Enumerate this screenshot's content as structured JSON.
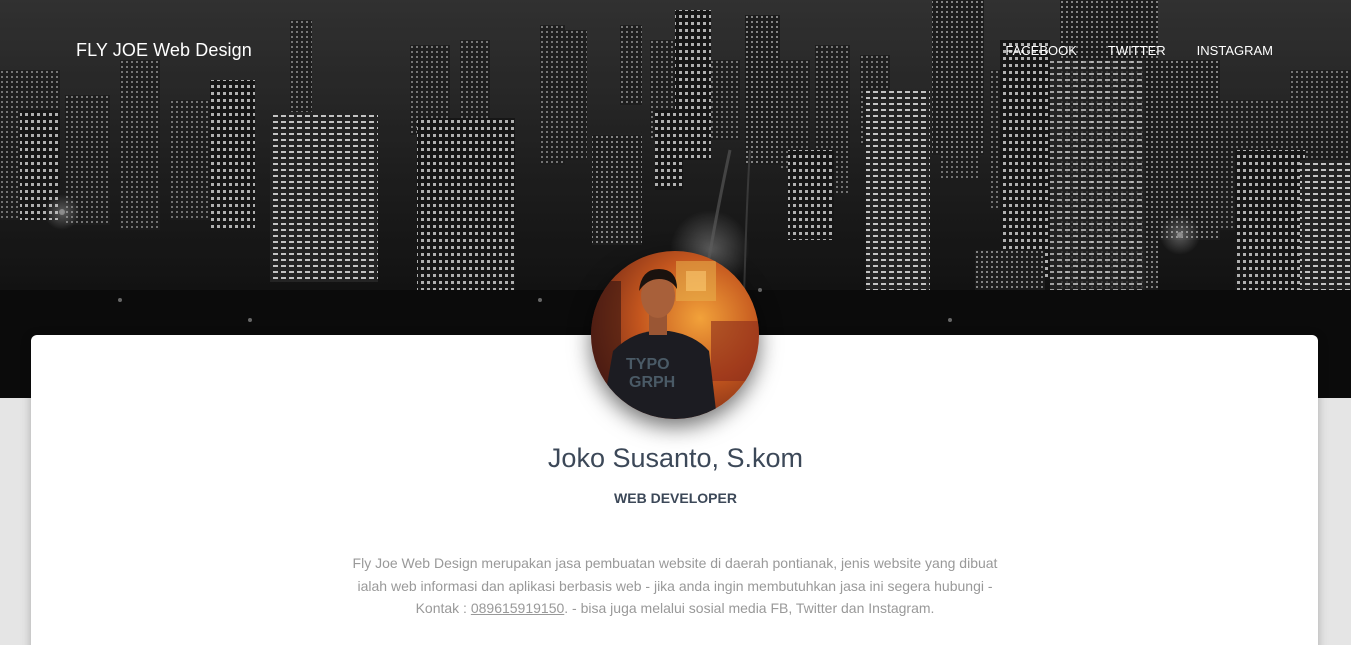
{
  "navbar": {
    "brand": "FLY JOE Web Design",
    "links": [
      "FACEBOOK",
      "TWITTER",
      "INSTAGRAM"
    ]
  },
  "profile": {
    "name": "Joko Susanto, S.kom",
    "title": "WEB DEVELOPER",
    "description_before": "Fly Joe Web Design merupakan jasa pembuatan website di daerah pontianak, jenis website yang dibuat ialah web informasi dan aplikasi berbasis web - jika anda ingin membutuhkan jasa ini segera hubungi - Kontak : ",
    "phone": "089615919150",
    "description_after": ". - bisa juga melalui sosial media FB, Twitter dan Instagram."
  },
  "colors": {
    "text_dark": "#3c4858",
    "text_muted": "#999999",
    "nav_text": "#ffffff",
    "background": "#e5e5e5",
    "card": "#ffffff"
  }
}
